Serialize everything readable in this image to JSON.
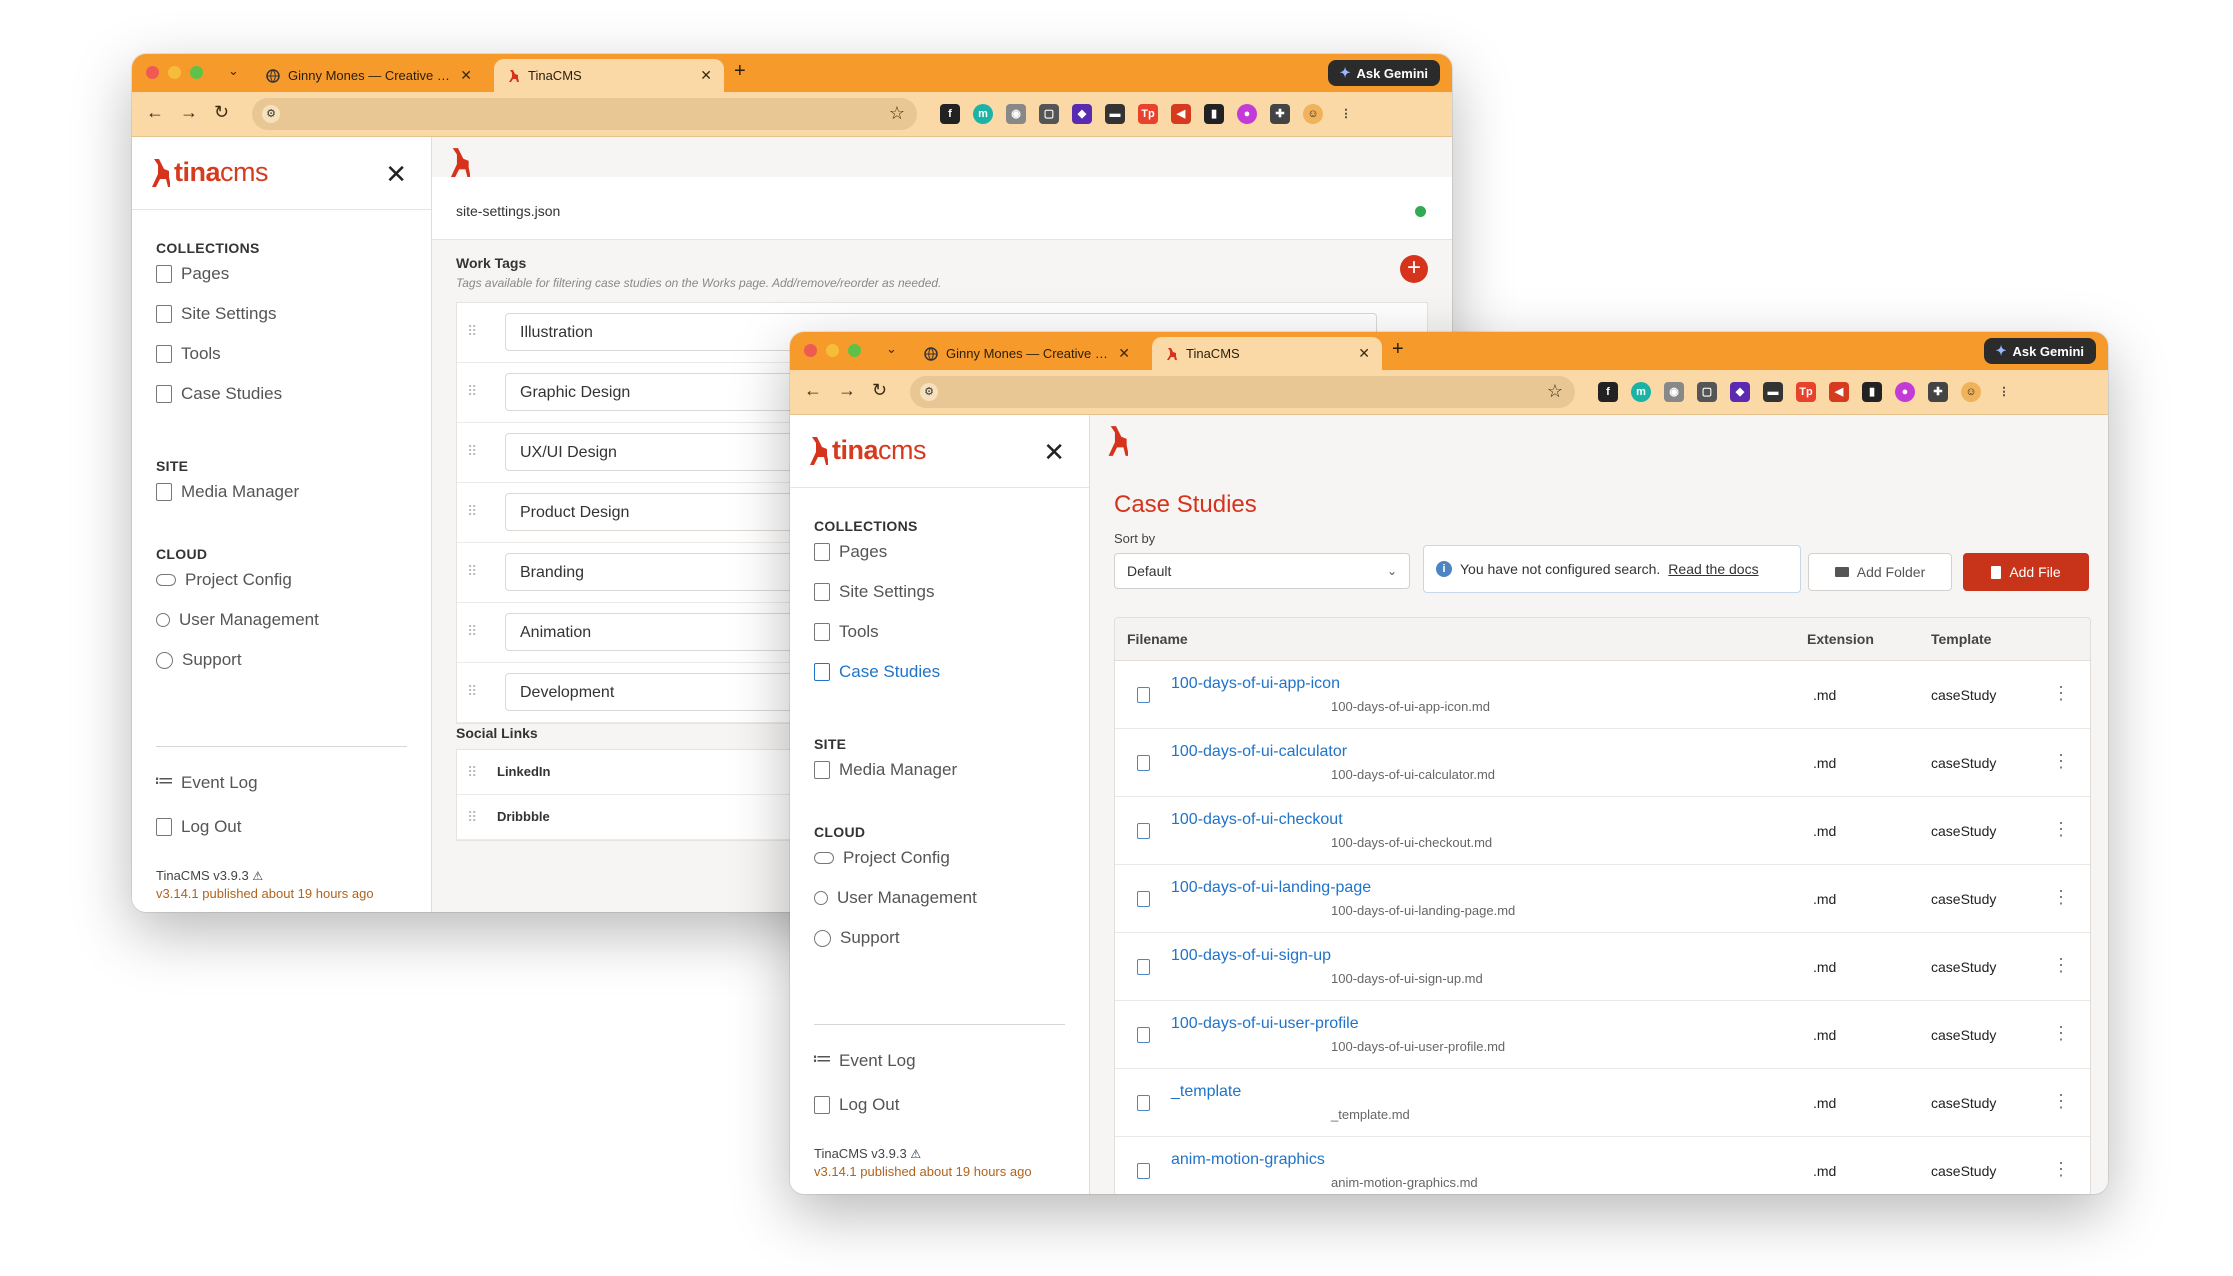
{
  "browser": {
    "tab1_title": "Ginny Mones — Creative Prob",
    "tab2_title": "TinaCMS",
    "new_tab": "+",
    "gemini_label": "Ask Gemini"
  },
  "sidebar": {
    "brand_tina": "tina",
    "brand_cms": "cms",
    "collections_heading": "COLLECTIONS",
    "collections": [
      "Pages",
      "Site Settings",
      "Tools",
      "Case Studies"
    ],
    "site_heading": "SITE",
    "media_manager": "Media Manager",
    "cloud_heading": "CLOUD",
    "project_config": "Project Config",
    "user_management": "User Management",
    "support": "Support",
    "event_log": "Event Log",
    "log_out": "Log Out",
    "version": "TinaCMS v3.9.3",
    "published": "v3.14.1 published about 19 hours ago"
  },
  "editor": {
    "filename": "site-settings.json",
    "work_tags_label": "Work Tags",
    "work_tags_desc": "Tags available for filtering case studies on the Works page. Add/remove/reorder as needed.",
    "tags": [
      "Illustration",
      "Graphic Design",
      "UX/UI Design",
      "Product Design",
      "Branding",
      "Animation",
      "Development"
    ],
    "social_links_label": "Social Links",
    "social_links": [
      "LinkedIn",
      "Dribbble"
    ]
  },
  "collection": {
    "title": "Case Studies",
    "sort_label": "Sort by",
    "sort_value": "Default",
    "notice_text": "You have not configured search.",
    "notice_link": "Read the docs",
    "add_folder": "Add Folder",
    "add_file": "Add File",
    "columns": [
      "Filename",
      "Extension",
      "Template"
    ],
    "rows": [
      {
        "name": "100-days-of-ui-app-icon",
        "path": "100-days-of-ui-app-icon.md",
        "ext": ".md",
        "tpl": "caseStudy"
      },
      {
        "name": "100-days-of-ui-calculator",
        "path": "100-days-of-ui-calculator.md",
        "ext": ".md",
        "tpl": "caseStudy"
      },
      {
        "name": "100-days-of-ui-checkout",
        "path": "100-days-of-ui-checkout.md",
        "ext": ".md",
        "tpl": "caseStudy"
      },
      {
        "name": "100-days-of-ui-landing-page",
        "path": "100-days-of-ui-landing-page.md",
        "ext": ".md",
        "tpl": "caseStudy"
      },
      {
        "name": "100-days-of-ui-sign-up",
        "path": "100-days-of-ui-sign-up.md",
        "ext": ".md",
        "tpl": "caseStudy"
      },
      {
        "name": "100-days-of-ui-user-profile",
        "path": "100-days-of-ui-user-profile.md",
        "ext": ".md",
        "tpl": "caseStudy"
      },
      {
        "name": "_template",
        "path": "_template.md",
        "ext": ".md",
        "tpl": "caseStudy"
      },
      {
        "name": "anim-motion-graphics",
        "path": "anim-motion-graphics.md",
        "ext": ".md",
        "tpl": "caseStudy"
      }
    ]
  },
  "colors": {
    "brand_red": "#d6331c",
    "tab_orange": "#f79a2c",
    "link_blue": "#1f73c9"
  }
}
